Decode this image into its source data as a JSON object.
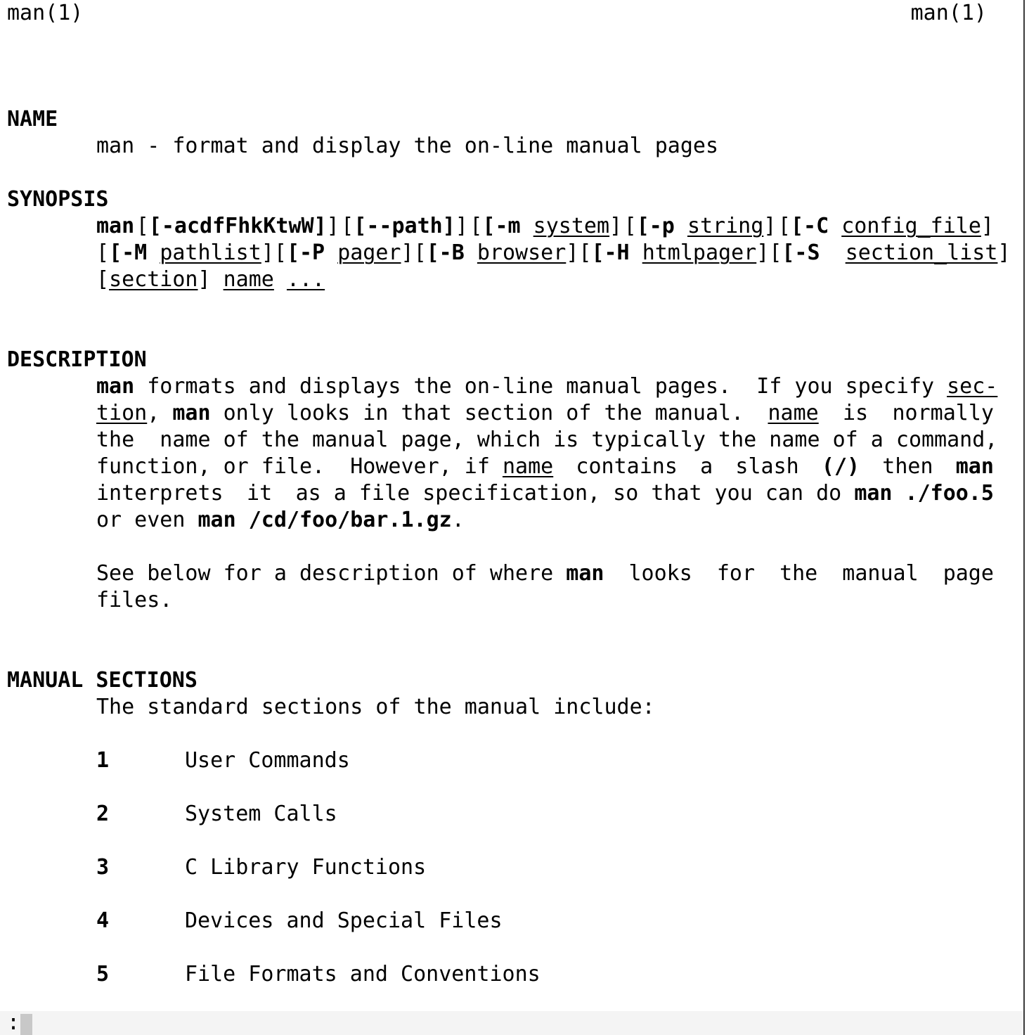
{
  "header": {
    "left": "man(1)",
    "right": "man(1)"
  },
  "name_section": {
    "heading": "NAME",
    "text": "man - format and display the on-line manual pages"
  },
  "synopsis": {
    "heading": "SYNOPSIS",
    "l1": {
      "cmd": "man",
      "opts": "[-acdfFhkKtwW]",
      "path": "[--path]",
      "m_flag": "[-m",
      "m_arg": "system",
      "p_flag": "[-p",
      "p_arg": "string",
      "c_flag": "[-C",
      "c_arg": "config_file"
    },
    "l2": {
      "M_flag": "[-M",
      "M_arg": "pathlist",
      "P_flag": "[-P",
      "P_arg": "pager",
      "B_flag": "[-B",
      "B_arg": "browser",
      "H_flag": "[-H",
      "H_arg": "htmlpager",
      "S_flag": "[-S",
      "S_arg": "section_list"
    },
    "l3": {
      "section": "section",
      "name": "name",
      "dots": "..."
    }
  },
  "description": {
    "heading": "DESCRIPTION",
    "l1": {
      "man": "man",
      "a": " formats and displays the on-line manual pages.  If you specify ",
      "sec": "sec-"
    },
    "l2": {
      "tion": "tion",
      "man": "man",
      "b": " only looks in that section of the manual.",
      "name": "name",
      "is": "is",
      "normally": "normally"
    },
    "l3": "the  name of the manual page, which is typically the name of a command,",
    "l4": {
      "a": "function, or file.  However, if ",
      "name": "name",
      "contains": "contains",
      "art": "a",
      "slash": "slash",
      "slash_sym": "(/)",
      "then": "then",
      "man": "man"
    },
    "l5": {
      "interprets": "interprets",
      "it": "it",
      "rest": "as a file specification, so that you can do ",
      "cmd": "man ./foo.5"
    },
    "l6": {
      "a": "or even ",
      "cmd": "man /cd/foo/bar.1.gz",
      "end": "."
    },
    "p2_l1": {
      "a": "See below for a description of where ",
      "man": "man",
      "looks": "looks",
      "for": "for",
      "the": "the",
      "manual": "manual",
      "page": "page"
    },
    "p2_l2": "files."
  },
  "manual_sections": {
    "heading": "MANUAL SECTIONS",
    "intro": "The standard sections of the manual include:",
    "items": [
      {
        "num": "1",
        "label": "User Commands"
      },
      {
        "num": "2",
        "label": "System Calls"
      },
      {
        "num": "3",
        "label": "C Library Functions"
      },
      {
        "num": "4",
        "label": "Devices and Special Files"
      },
      {
        "num": "5",
        "label": "File Formats and Conventions"
      }
    ]
  },
  "prompt": ":"
}
